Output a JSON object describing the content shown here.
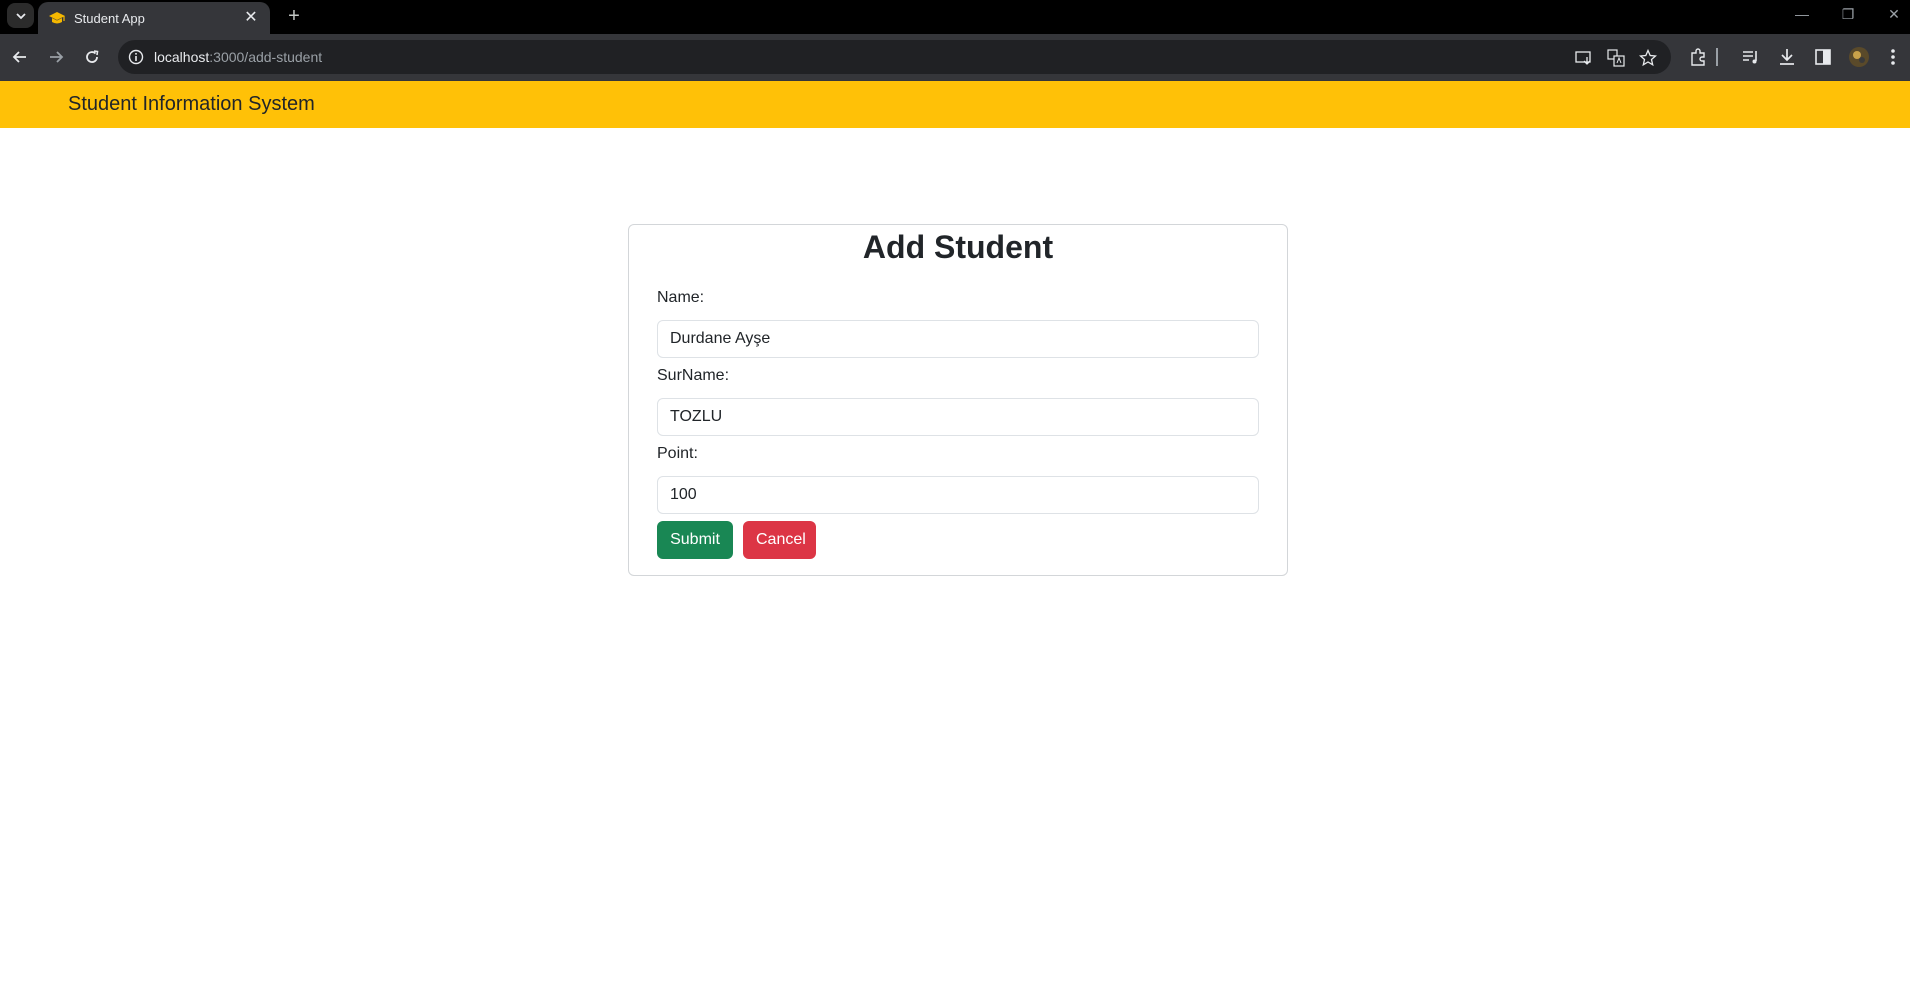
{
  "browser": {
    "tab_title": "Student App",
    "url_host": "localhost",
    "url_path": ":3000/add-student",
    "tab_close": "✕",
    "new_tab": "+",
    "window_controls": [
      "—",
      "❐",
      "✕"
    ]
  },
  "navbar": {
    "brand": "Student Information System",
    "background_color": "#ffc107"
  },
  "form": {
    "title": "Add Student",
    "fields": [
      {
        "label": "Name:",
        "value": "Durdane Ayşe"
      },
      {
        "label": "SurName:",
        "value": "TOZLU"
      },
      {
        "label": "Point:",
        "value": "100"
      }
    ],
    "submit_label": "Submit",
    "cancel_label": "Cancel",
    "submit_color": "#198754",
    "cancel_color": "#dc3545"
  }
}
